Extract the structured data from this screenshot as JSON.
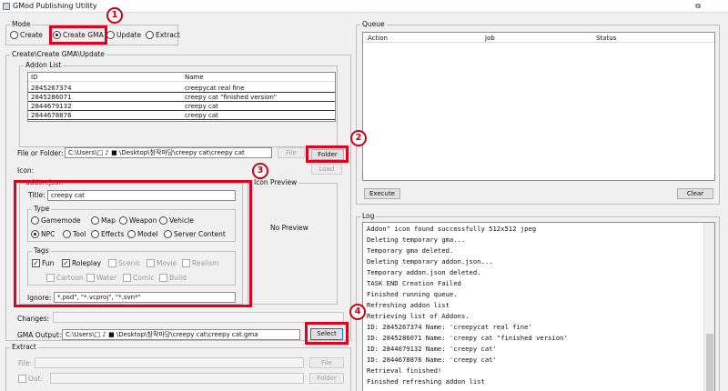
{
  "window": {
    "title": "GMod Publishing Utility",
    "restore_glyph": "⧉"
  },
  "mode": {
    "legend": "Mode",
    "options": [
      "Create",
      "Create GMA",
      "Update",
      "Extract"
    ],
    "selected": "Create GMA"
  },
  "create_panel": {
    "legend": "Create\\Create GMA\\Update",
    "addon_list": {
      "legend": "Addon List",
      "columns": [
        "ID",
        "Name"
      ],
      "rows": [
        {
          "id": "2845267374",
          "name": "creepycat real fine"
        },
        {
          "id": "2845286071",
          "name": "creepy cat \"finished version\""
        },
        {
          "id": "2844679132",
          "name": "creepy cat"
        },
        {
          "id": "2844678876",
          "name": "creepy cat"
        }
      ]
    },
    "file_or_folder": {
      "label": "File or Folder:",
      "value": "C:\\Users\\□  ♪ ■ \\Desktop\\창작마당\\creepy cat\\creepy cat",
      "file_btn": "File",
      "folder_btn": "Folder"
    },
    "icon": {
      "label": "Icon:",
      "load_btn": "Load"
    },
    "addon_json": {
      "legend": "addon.json",
      "title_label": "Title:",
      "title_value": "creepy cat",
      "type": {
        "legend": "Type",
        "options": [
          "Gamemode",
          "Map",
          "Weapon",
          "Vehicle",
          "NPC",
          "Tool",
          "Effects",
          "Model",
          "Server Content"
        ],
        "selected": "NPC"
      },
      "tags": {
        "legend": "Tags",
        "items": [
          {
            "label": "Fun",
            "checked": true,
            "enabled": true
          },
          {
            "label": "Roleplay",
            "checked": true,
            "enabled": true
          },
          {
            "label": "Scenic",
            "checked": false,
            "enabled": false
          },
          {
            "label": "Movie",
            "checked": false,
            "enabled": false
          },
          {
            "label": "Realism",
            "checked": false,
            "enabled": false
          },
          {
            "label": "Cartoon",
            "checked": false,
            "enabled": false
          },
          {
            "label": "Water",
            "checked": false,
            "enabled": false
          },
          {
            "label": "Comic",
            "checked": false,
            "enabled": false
          },
          {
            "label": "Build",
            "checked": false,
            "enabled": false
          }
        ]
      },
      "ignore_label": "Ignore:",
      "ignore_value": "*.psd\", \"*.vcproj\", \"*.svn*\""
    },
    "icon_preview": {
      "legend": "Icon Preview",
      "text": "No Preview"
    },
    "changes_label": "Changes:",
    "gma_output": {
      "label": "GMA Output:",
      "value": "C:\\Users\\□  ♪ ■ \\Desktop\\창작마당\\creepy cat\\creepy cat.gma",
      "select_btn": "Select"
    }
  },
  "extract": {
    "legend": "Extract",
    "file_label": "File:",
    "file_btn": "File",
    "out_label": "Out:",
    "folder_btn": "Folder"
  },
  "queue": {
    "legend": "Queue",
    "columns": [
      "Action",
      "Job",
      "Status"
    ],
    "execute_btn": "Execute",
    "clear_btn": "Clear"
  },
  "log": {
    "legend": "Log",
    "lines": [
      "Addon\" icon found successfully 512x512 jpeg",
      "Deleting temporary gma...",
      "Temporary gma deleted.",
      "Deleting temporary addon.json...",
      "Temporary addon.json deleted.",
      "TASK END Creation Failed",
      "Finished running queue.",
      "Refreshing addon list",
      "Retrieving list of Addons.",
      "ID: 2845267374  Name: 'creepycat real fine'",
      "ID: 2845286071  Name: 'creepy cat \"finished version'",
      "ID: 2844679132  Name: 'creepy cat'",
      "ID: 2844678876  Name: 'creepy cat'",
      "Retrieval finished!",
      "Finished refreshing addon list"
    ]
  },
  "callouts": [
    "1",
    "2",
    "3",
    "4"
  ],
  "colors": {
    "highlight": "#e3001b",
    "background": "#f0f0f0"
  }
}
